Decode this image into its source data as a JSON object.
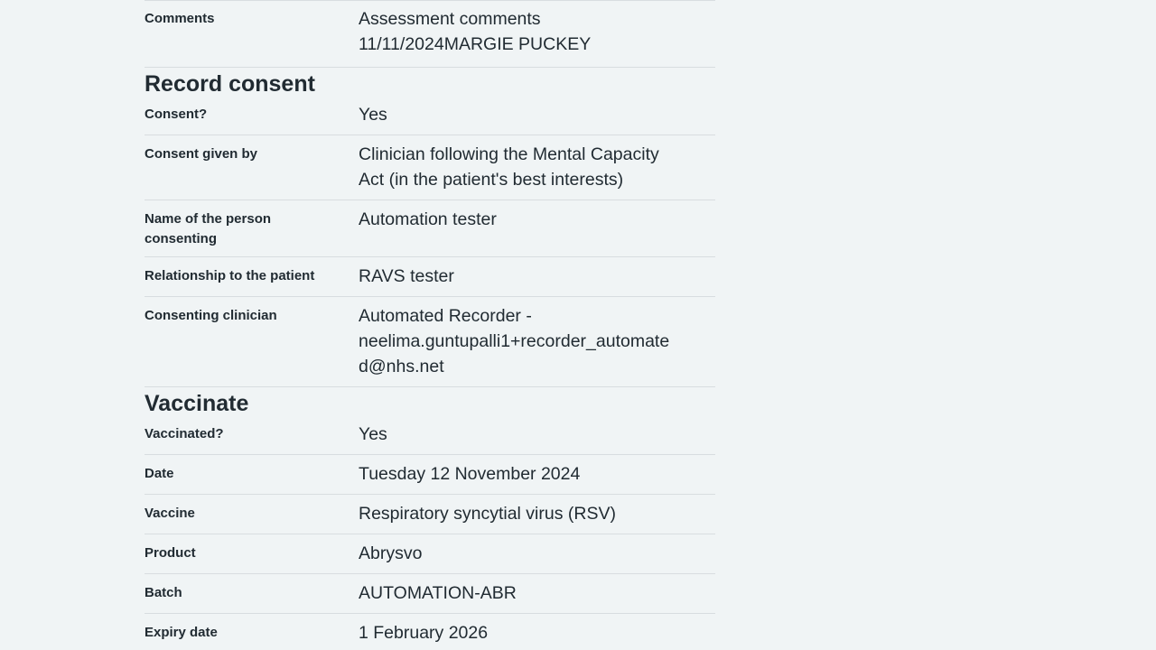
{
  "assessment": {
    "comments_label": "Comments",
    "comments_line1": "Assessment comments",
    "comments_line2": "11/11/2024MARGIE PUCKEY"
  },
  "consent": {
    "heading": "Record consent",
    "rows": [
      {
        "key": "Consent?",
        "value": "Yes"
      },
      {
        "key": "Consent given by",
        "value_lines": [
          "Clinician following the Mental Capacity",
          "Act (in the patient's best interests)"
        ]
      },
      {
        "key": "Name of the person consenting",
        "value": "Automation tester"
      },
      {
        "key": "Relationship to the patient",
        "value": "RAVS tester"
      },
      {
        "key": "Consenting clinician",
        "value_lines": [
          "Automated Recorder -",
          "neelima.guntupalli1+recorder_automate",
          "d@nhs.net"
        ]
      }
    ]
  },
  "vaccinate": {
    "heading": "Vaccinate",
    "rows": [
      {
        "key": "Vaccinated?",
        "value": "Yes"
      },
      {
        "key": "Date",
        "value": "Tuesday 12 November 2024"
      },
      {
        "key": "Vaccine",
        "value": "Respiratory syncytial virus (RSV)"
      },
      {
        "key": "Product",
        "value": "Abrysvo"
      },
      {
        "key": "Batch",
        "value": "AUTOMATION-ABR"
      },
      {
        "key": "Expiry date",
        "value": "1 February 2026"
      }
    ]
  }
}
